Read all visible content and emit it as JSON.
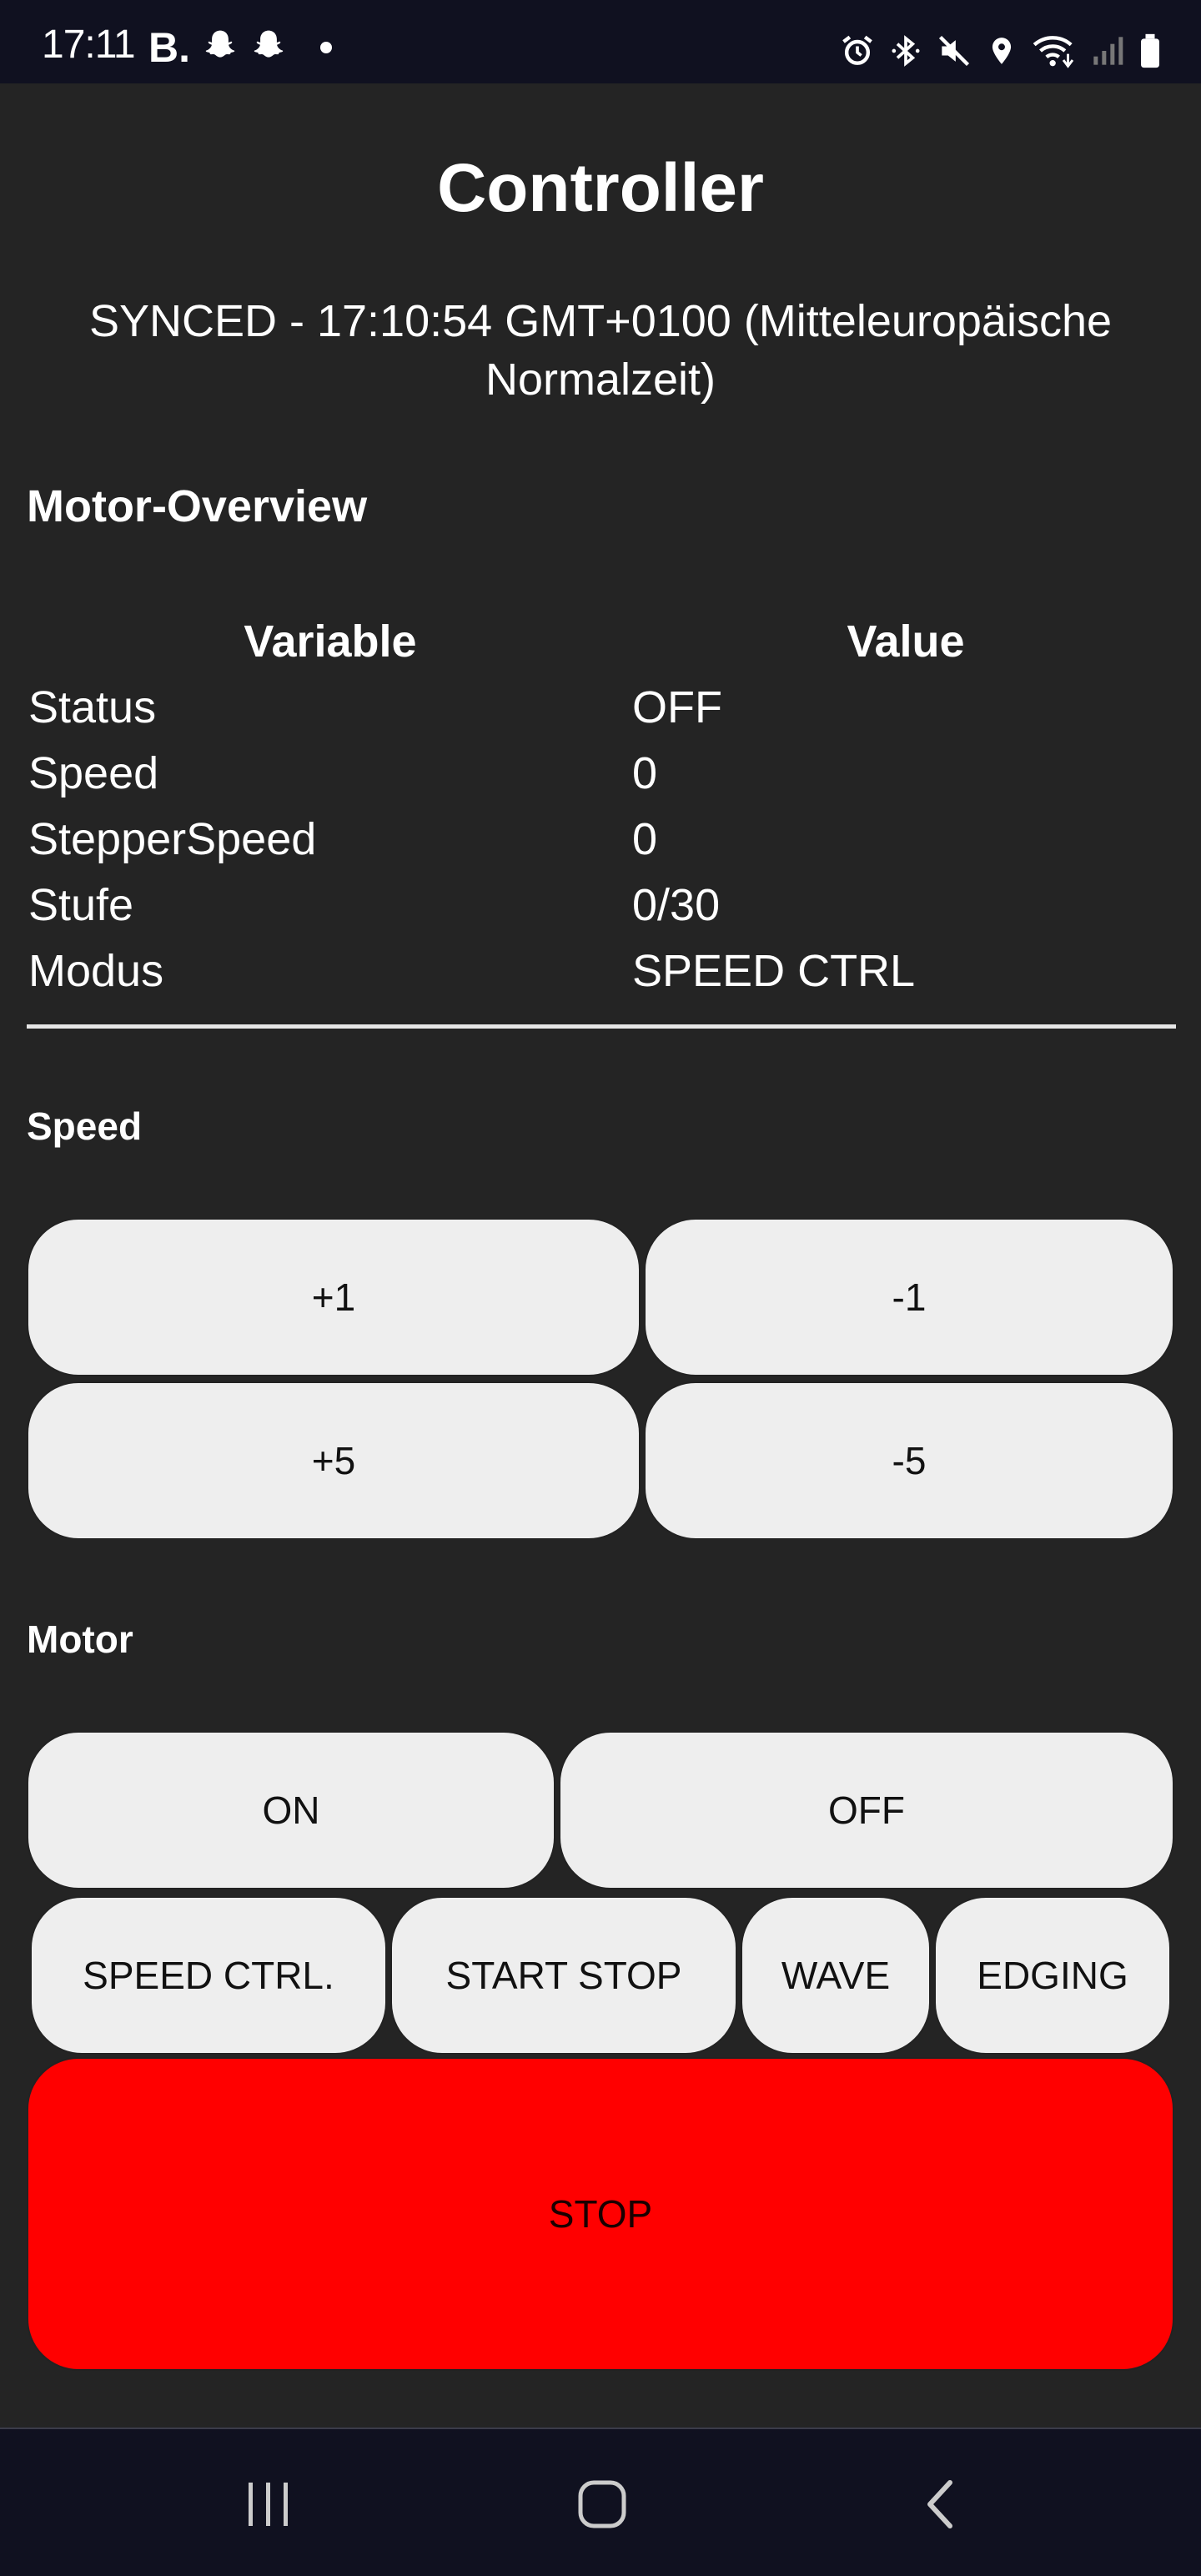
{
  "status_bar": {
    "time": "17:11",
    "left_icons": [
      "booking-b-icon",
      "snapchat-icon",
      "snapchat-icon",
      "notification-dot-icon"
    ],
    "right_icons": [
      "alarm-icon",
      "bluetooth-icon",
      "mute-icon",
      "location-icon",
      "wifi-icon",
      "signal-icon",
      "battery-icon"
    ],
    "b_glyph": "B."
  },
  "page": {
    "title": "Controller",
    "sync_status": "SYNCED - 17:10:54 GMT+0100 (Mitteleuropäische Normalzeit)"
  },
  "overview": {
    "heading": "Motor-Overview",
    "columns": [
      "Variable",
      "Value"
    ],
    "rows": [
      {
        "variable": "Status",
        "value": "OFF"
      },
      {
        "variable": "Speed",
        "value": "0"
      },
      {
        "variable": "StepperSpeed",
        "value": "0"
      },
      {
        "variable": "Stufe",
        "value": "0/30"
      },
      {
        "variable": "Modus",
        "value": "SPEED CTRL"
      }
    ]
  },
  "speed": {
    "heading": "Speed",
    "buttons": [
      "+1",
      "-1",
      "+5",
      "-5"
    ]
  },
  "motor": {
    "heading": "Motor",
    "on_label": "ON",
    "off_label": "OFF",
    "modes": [
      "SPEED CTRL.",
      "START STOP",
      "WAVE",
      "EDGING"
    ],
    "stop_label": "STOP"
  },
  "colors": {
    "background": "#242424",
    "bars": "#101120",
    "button": "#eeeeee",
    "stop": "#ff0000"
  },
  "nav_bar": {
    "items": [
      "recent-apps-icon",
      "home-icon",
      "back-icon"
    ]
  }
}
